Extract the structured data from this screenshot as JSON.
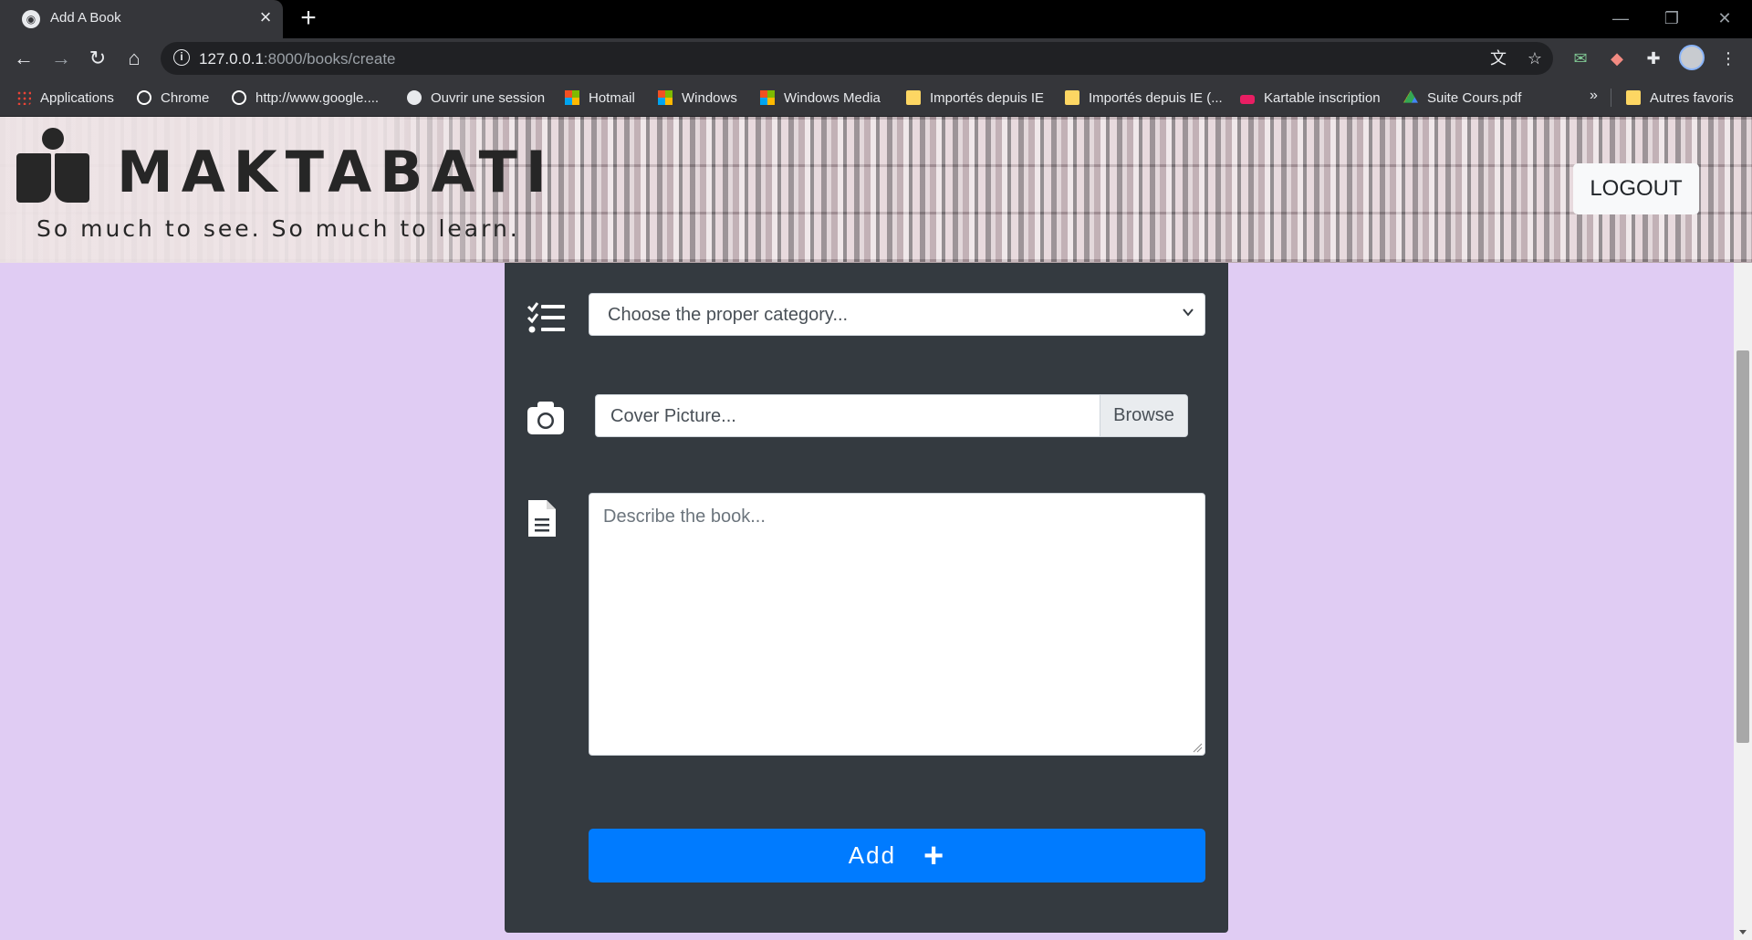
{
  "browser": {
    "tab_title": "Add A Book",
    "url_host": "127.0.0.1",
    "url_path": ":8000/books/create",
    "bookmarks": [
      {
        "label": "Applications",
        "icon": "apps-grid-icon",
        "color": "#ea4335"
      },
      {
        "label": "Chrome",
        "icon": "google-icon",
        "color": "#ffffff"
      },
      {
        "label": "http://www.google....",
        "icon": "google-icon",
        "color": "#ffffff"
      },
      {
        "label": "Ouvrir une session",
        "icon": "globe-icon",
        "color": "#e8eaed"
      },
      {
        "label": "Hotmail",
        "icon": "windows-icon",
        "color": "#f25022"
      },
      {
        "label": "Windows",
        "icon": "windows-icon",
        "color": "#f25022"
      },
      {
        "label": "Windows Media",
        "icon": "windows-icon",
        "color": "#f25022"
      },
      {
        "label": "Importés depuis IE",
        "icon": "folder-icon",
        "color": "#fdd663"
      },
      {
        "label": "Importés depuis IE (...",
        "icon": "folder-icon",
        "color": "#fdd663"
      },
      {
        "label": "Kartable inscription",
        "icon": "kartable-icon",
        "color": "#e91e63"
      },
      {
        "label": "Suite Cours.pdf",
        "icon": "google-drive-icon",
        "color": "#34a853"
      }
    ],
    "bookmarks_overflow": "»",
    "other_bookmarks": "Autres favoris"
  },
  "header": {
    "brand": "MAKTABATI",
    "slogan": "So much to see. So much to learn.",
    "logout_label": "LOGOUT"
  },
  "form": {
    "category_select": {
      "selected": "Choose the proper category...",
      "icon": "tasks-list-icon"
    },
    "cover_picture": {
      "placeholder": "Cover Picture...",
      "browse_label": "Browse",
      "icon": "camera-icon"
    },
    "description": {
      "placeholder": "Describe the book...",
      "icon": "document-icon"
    },
    "submit": {
      "label": "Add",
      "icon": "plus-icon"
    }
  },
  "colors": {
    "page_background": "#e0ccf3",
    "panel_background": "#343a40",
    "primary_button": "#007bff"
  }
}
